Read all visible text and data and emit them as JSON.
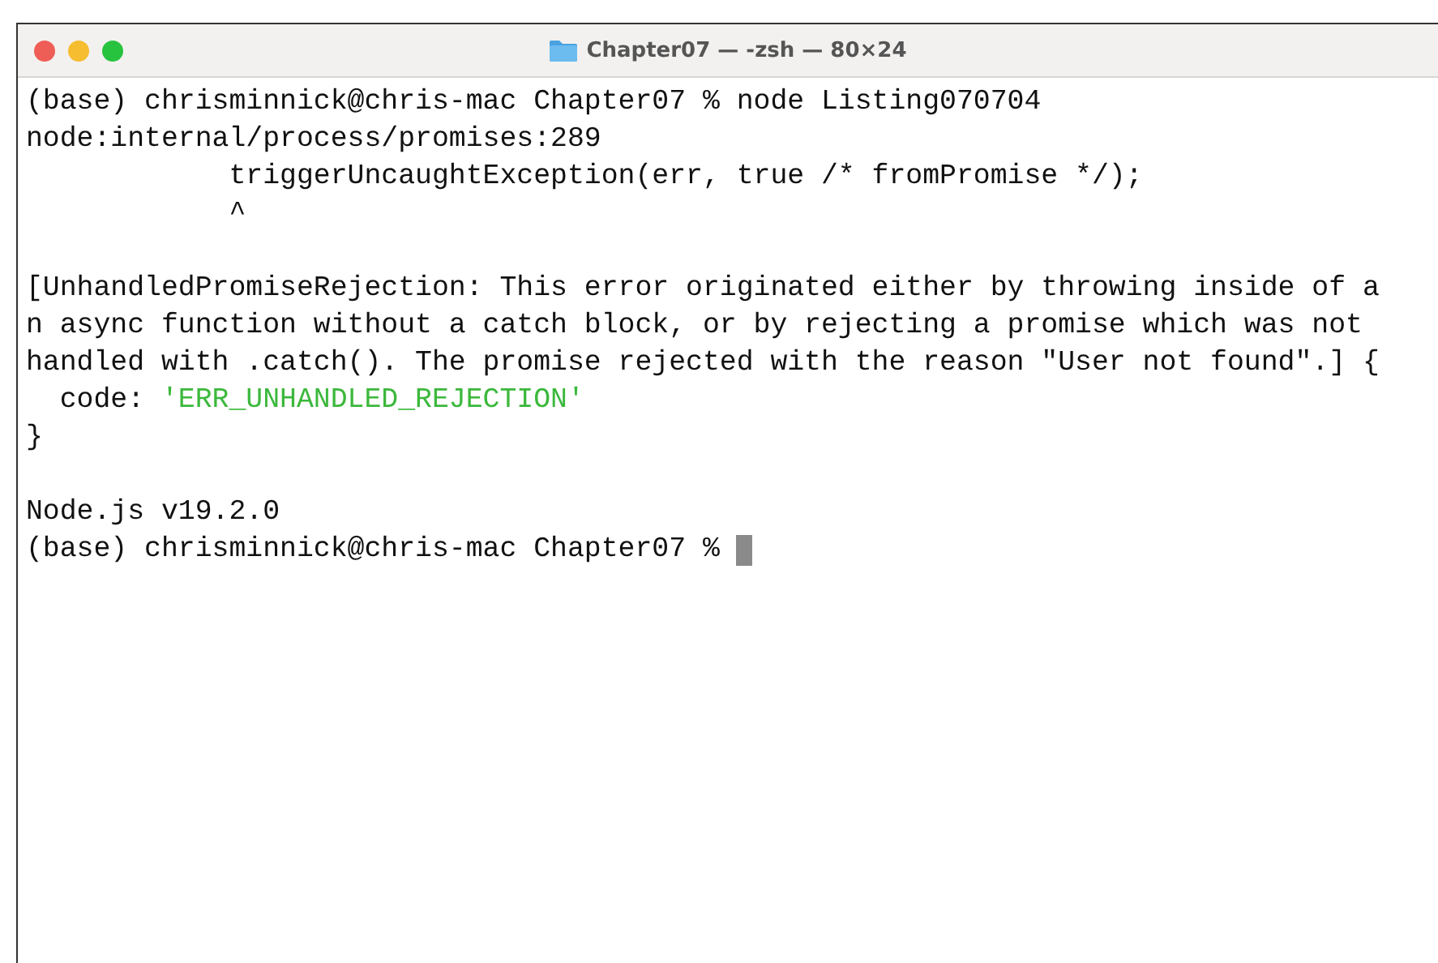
{
  "window": {
    "title": "Chapter07 — -zsh — 80×24"
  },
  "terminal": {
    "lines": [
      {
        "kind": "text",
        "segments": [
          {
            "kind": "plain",
            "text": "(base) chrisminnick@chris-mac Chapter07 % node Listing070704"
          }
        ]
      },
      {
        "kind": "text",
        "segments": [
          {
            "kind": "plain",
            "text": "node:internal/process/promises:289"
          }
        ]
      },
      {
        "kind": "text",
        "segments": [
          {
            "kind": "plain",
            "text": "            triggerUncaughtException(err, true /* fromPromise */);"
          }
        ]
      },
      {
        "kind": "text",
        "segments": [
          {
            "kind": "plain",
            "text": "            ^"
          }
        ]
      },
      {
        "kind": "blank"
      },
      {
        "kind": "text",
        "segments": [
          {
            "kind": "plain",
            "text": "[UnhandledPromiseRejection: This error originated either by throwing inside of a"
          }
        ]
      },
      {
        "kind": "text",
        "segments": [
          {
            "kind": "plain",
            "text": "n async function without a catch block, or by rejecting a promise which was not"
          }
        ]
      },
      {
        "kind": "text",
        "segments": [
          {
            "kind": "plain",
            "text": "handled with .catch(). The promise rejected with the reason \"User not found\".] {"
          }
        ]
      },
      {
        "kind": "text",
        "segments": [
          {
            "kind": "plain",
            "text": "  code: "
          },
          {
            "kind": "string",
            "text": "'ERR_UNHANDLED_REJECTION'"
          }
        ]
      },
      {
        "kind": "text",
        "segments": [
          {
            "kind": "plain",
            "text": "}"
          }
        ]
      },
      {
        "kind": "blank"
      },
      {
        "kind": "text",
        "segments": [
          {
            "kind": "plain",
            "text": "Node.js v19.2.0"
          }
        ]
      },
      {
        "kind": "text",
        "cursor": true,
        "segments": [
          {
            "kind": "plain",
            "text": "(base) chrisminnick@chris-mac Chapter07 % "
          }
        ]
      }
    ]
  }
}
